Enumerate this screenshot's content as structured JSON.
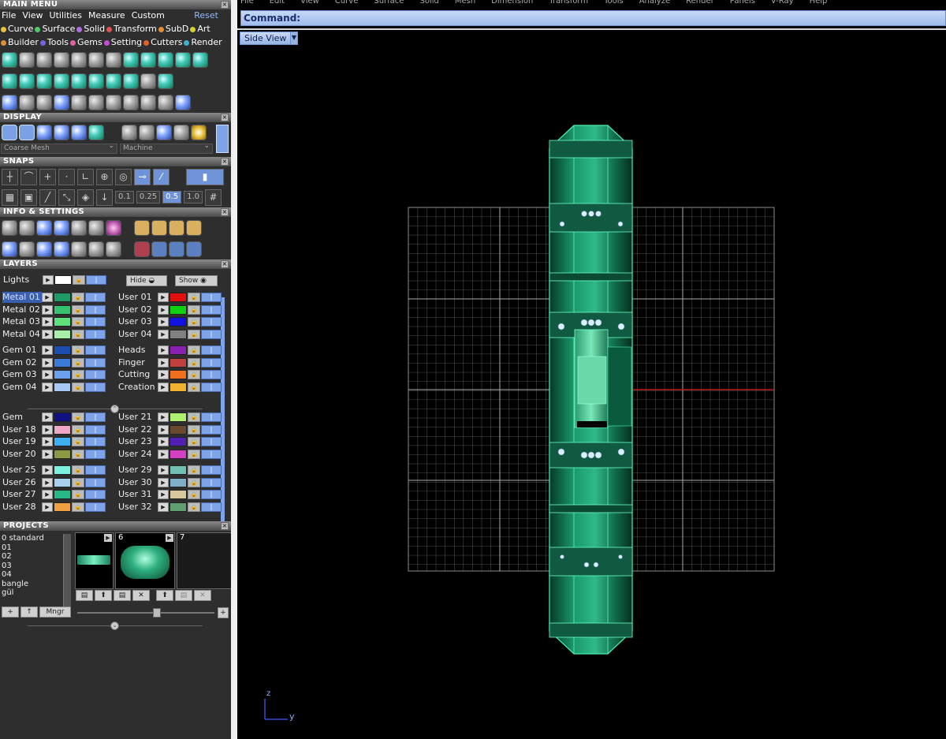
{
  "main_menu": {
    "title": "MAIN MENU",
    "menu": [
      "File",
      "View",
      "Utilities",
      "Measure",
      "Custom"
    ],
    "reset": "Reset",
    "categories1": [
      {
        "label": "Curve",
        "color": "#e8c23a"
      },
      {
        "label": "Surface",
        "color": "#4fc86a"
      },
      {
        "label": "Solid",
        "color": "#b06ce0"
      },
      {
        "label": "Transform",
        "color": "#e05050"
      },
      {
        "label": "SubD",
        "color": "#e88a30"
      },
      {
        "label": "Art",
        "color": "#d8d030"
      }
    ],
    "categories2": [
      {
        "label": "Builder",
        "color": "#e09030"
      },
      {
        "label": "Tools",
        "color": "#7a60e0"
      },
      {
        "label": "Gems",
        "color": "#e060a0"
      },
      {
        "label": "Setting",
        "color": "#c050d0"
      },
      {
        "label": "Cutters",
        "color": "#e06030"
      },
      {
        "label": "Render",
        "color": "#40b0d0"
      }
    ]
  },
  "display": {
    "title": "DISPLAY",
    "left_dropdown": "Coarse Mesh",
    "right_dropdown": "Machine"
  },
  "snaps": {
    "title": "SNAPS",
    "values": [
      "0.1",
      "0.25",
      "0.5",
      "1.0"
    ]
  },
  "info": {
    "title": "INFO & SETTINGS"
  },
  "layers": {
    "title": "LAYERS",
    "lights": "Lights",
    "hide": "Hide",
    "show": "Show",
    "left": [
      {
        "name": "Metal 01",
        "color": "#1e9a64",
        "selected": true
      },
      {
        "name": "Metal 02",
        "color": "#38c070"
      },
      {
        "name": "Metal 03",
        "color": "#5fe07a"
      },
      {
        "name": "Metal 04",
        "color": "#a8f0a8"
      },
      {
        "name": "Gem 01",
        "color": "#1a4fb0"
      },
      {
        "name": "Gem 02",
        "color": "#3a7ad8"
      },
      {
        "name": "Gem 03",
        "color": "#6aa0ee"
      },
      {
        "name": "Gem 04",
        "color": "#a8c8f8"
      },
      {
        "name": "Gem",
        "color": "#101080"
      },
      {
        "name": "User 18",
        "color": "#f0a8c8"
      },
      {
        "name": "User 19",
        "color": "#3ab0f0"
      },
      {
        "name": "User 20",
        "color": "#8a9a40"
      },
      {
        "name": "User 25",
        "color": "#7af0e0"
      },
      {
        "name": "User 26",
        "color": "#a8d0f0"
      },
      {
        "name": "User 27",
        "color": "#28b888"
      },
      {
        "name": "User 28",
        "color": "#f0a040"
      }
    ],
    "right": [
      {
        "name": "User 01",
        "color": "#e01010"
      },
      {
        "name": "User 02",
        "color": "#10d010"
      },
      {
        "name": "User 03",
        "color": "#1010e0"
      },
      {
        "name": "User 04",
        "color": "#808080"
      },
      {
        "name": "Heads",
        "color": "#8a20b0"
      },
      {
        "name": "Finger",
        "color": "#c04040"
      },
      {
        "name": "Cutting",
        "color": "#f07020"
      },
      {
        "name": "Creation",
        "color": "#f0b030"
      },
      {
        "name": "User 21",
        "color": "#b0f070"
      },
      {
        "name": "User 22",
        "color": "#6a4a30"
      },
      {
        "name": "User 23",
        "color": "#5020b0"
      },
      {
        "name": "User 24",
        "color": "#d040c0"
      },
      {
        "name": "User 29",
        "color": "#70c0b0"
      },
      {
        "name": "User 30",
        "color": "#80b0c8"
      },
      {
        "name": "User 31",
        "color": "#d8c8a0"
      },
      {
        "name": "User 32",
        "color": "#60a070"
      }
    ]
  },
  "projects": {
    "title": "PROJECTS",
    "list": [
      "0 standard",
      "01",
      "02",
      "03",
      "04",
      "bangle",
      "gül"
    ],
    "slot_numbers": [
      "6",
      "7"
    ],
    "mngr": "Mngr"
  },
  "viewport": {
    "command_label": "Command:",
    "top_menu": [
      "File",
      "Edit",
      "View",
      "Curve",
      "Surface",
      "Solid",
      "Mesh",
      "Dimension",
      "Transform",
      "Tools",
      "Analyze",
      "Render",
      "Panels",
      "V-Ray",
      "Help"
    ],
    "view_name": "Side View",
    "axis_z": "z",
    "axis_y": "y"
  }
}
